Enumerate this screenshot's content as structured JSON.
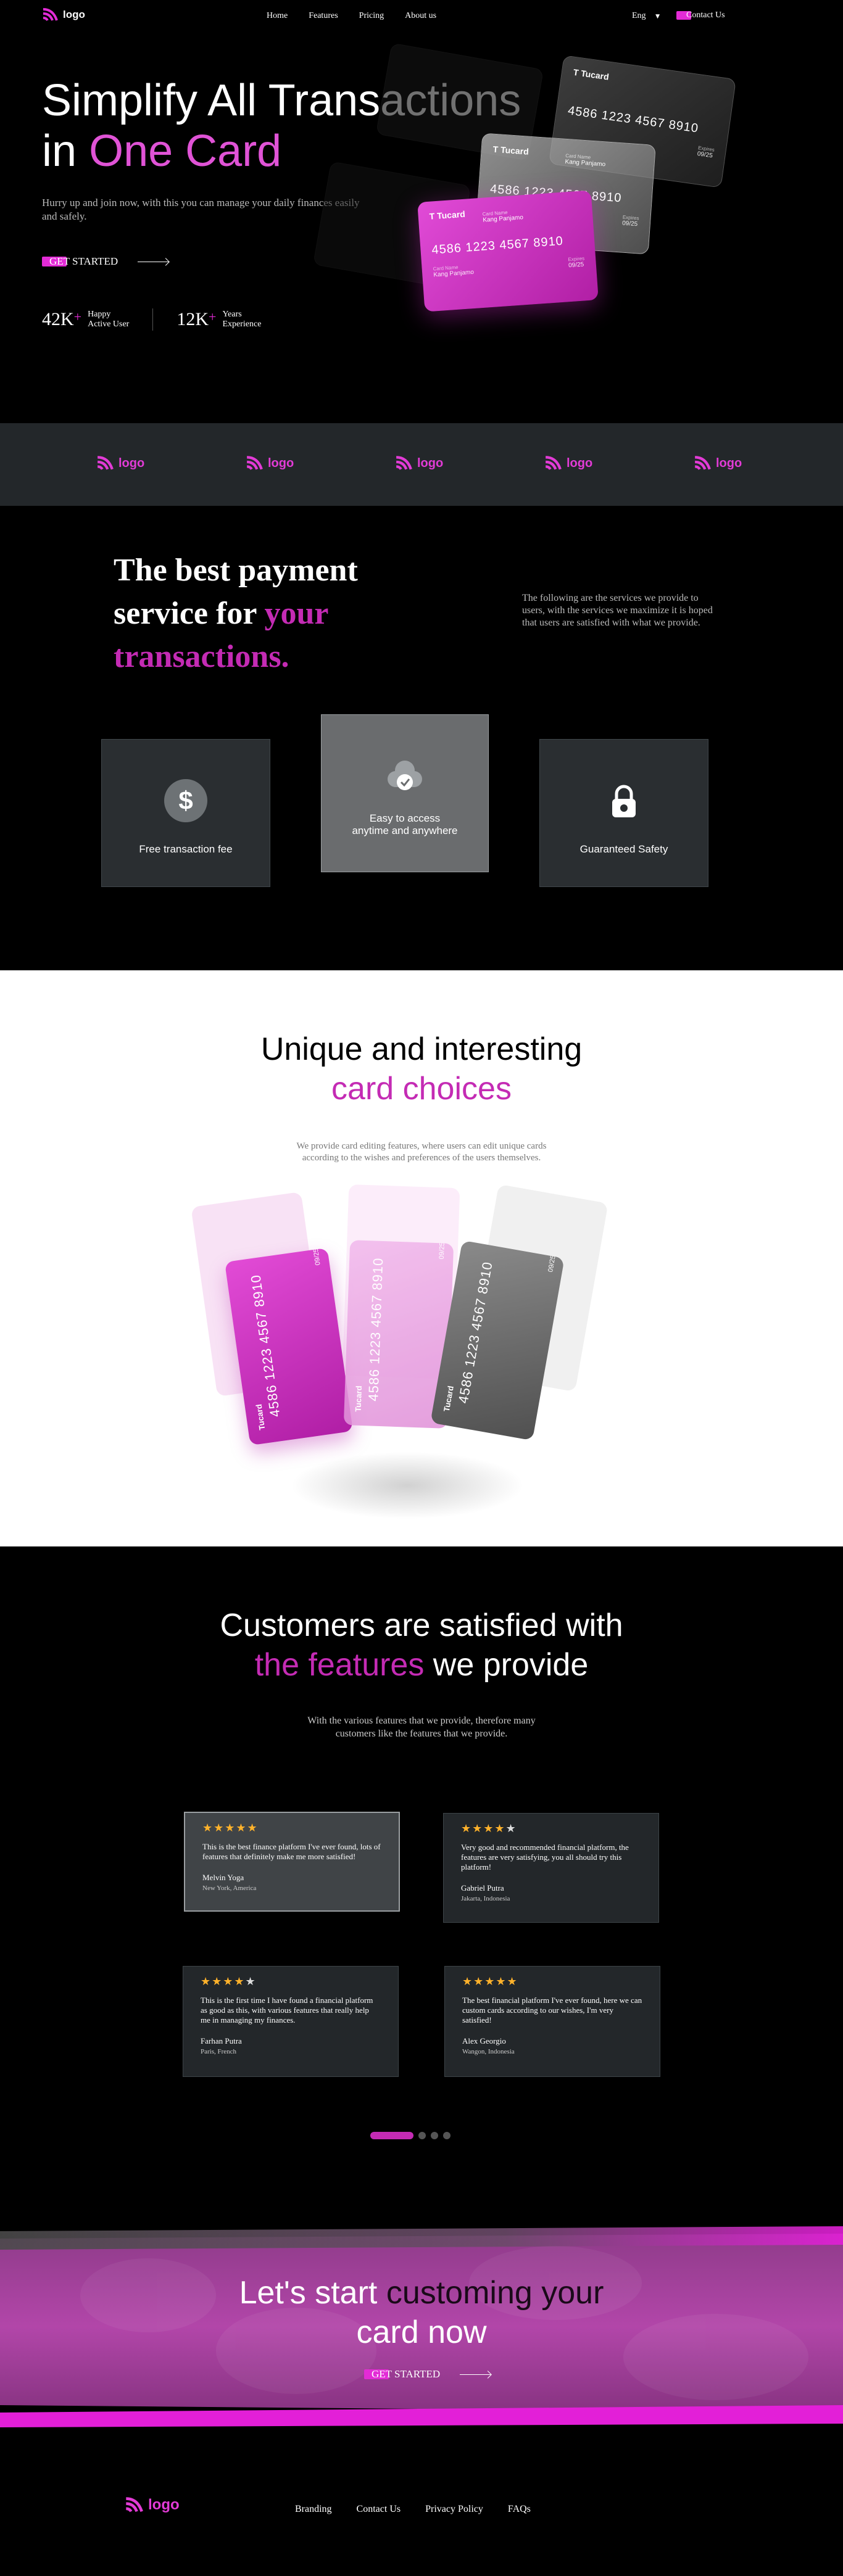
{
  "nav": {
    "logo": "logo",
    "links": [
      "Home",
      "Features",
      "Pricing",
      "About us"
    ],
    "lang": "Eng",
    "contact": "Contact Us"
  },
  "hero": {
    "title_line1": "Simplify All Transactions",
    "title_in": "in",
    "title_highlight": "One Card",
    "subtitle": "Hurry up and join now, with this you can manage your daily finances easily and safely.",
    "cta": "GET STARTED",
    "stats": [
      {
        "num": "42K",
        "plus": "+",
        "label1": "Happy",
        "label2": "Active User"
      },
      {
        "num": "12K",
        "plus": "+",
        "label1": "Years",
        "label2": "Experience"
      }
    ]
  },
  "card": {
    "brand": "Tucard",
    "number": "4586 1223 4567 8910",
    "holder_label": "Card Name",
    "holder": "Kang Panjamo",
    "expiry_label": "Expires",
    "expiry": "09/25",
    "holder_alt": "Kang Panjamo",
    "holder_short": "Kang Panjom"
  },
  "strip": {
    "logos": [
      "logo",
      "logo",
      "logo",
      "logo",
      "logo"
    ]
  },
  "services": {
    "title1": "The best payment",
    "title2": "service for",
    "title_highlight1": "your",
    "title_highlight2": "transactions.",
    "desc": "The following are the services we provide to users, with the services we maximize it is hoped that users are satisfied with what we provide.",
    "features": [
      {
        "label": "Free transaction fee",
        "icon": "dollar-icon"
      },
      {
        "label1": "Easy to access",
        "label2": "anytime and anywhere",
        "icon": "cloud-check-icon"
      },
      {
        "label": "Guaranteed Safety",
        "icon": "lock-icon"
      }
    ]
  },
  "unique": {
    "title": "Unique and interesting",
    "title_highlight": "card choices",
    "desc1": "We provide card editing features, where users can edit unique cards",
    "desc2": "according to the wishes and preferences of the users themselves."
  },
  "testimonials": {
    "title": "Customers are satisfied with",
    "title_highlight": "the features",
    "title_rest": "we provide",
    "desc1": "With the various features that we provide, therefore many",
    "desc2": "customers like the features that we provide.",
    "reviews": [
      {
        "stars": 5,
        "text": "This is the best finance platform I've ever found, lots of features that definitely make me more satisfied!",
        "name": "Melvin Yoga",
        "location": "New York, America"
      },
      {
        "stars": 4,
        "text": "Very good and recommended financial platform, the features are very satisfying, you all should try this platform!",
        "name": "Gabriel Putra",
        "location": "Jakarta, Indonesia"
      },
      {
        "stars": 4,
        "text": "This is the first time I have found a financial platform as good as this, with various features that really help me in managing my finances.",
        "name": "Farhan Putra",
        "location": "Paris, French"
      },
      {
        "stars": 5,
        "text": "The best financial platform I've ever found, here we can custom cards according to our wishes, I'm very satisfied!",
        "name": "Alex Georgio",
        "location": "Wangon, Indonesia"
      }
    ],
    "active_slide": 1,
    "slide_count": 4
  },
  "banner": {
    "title1": "Let's start",
    "title_dark": "customing your",
    "title2": "card now",
    "cta": "GET STARTED"
  },
  "footer": {
    "logo": "logo",
    "links": [
      "Branding",
      "Contact Us",
      "Privacy Policy",
      "FAQs"
    ]
  },
  "colors": {
    "accent": "#c42bb4",
    "accent_bright": "#e32bd6",
    "strip_bg": "#23272a",
    "star": "#ffb22b"
  }
}
